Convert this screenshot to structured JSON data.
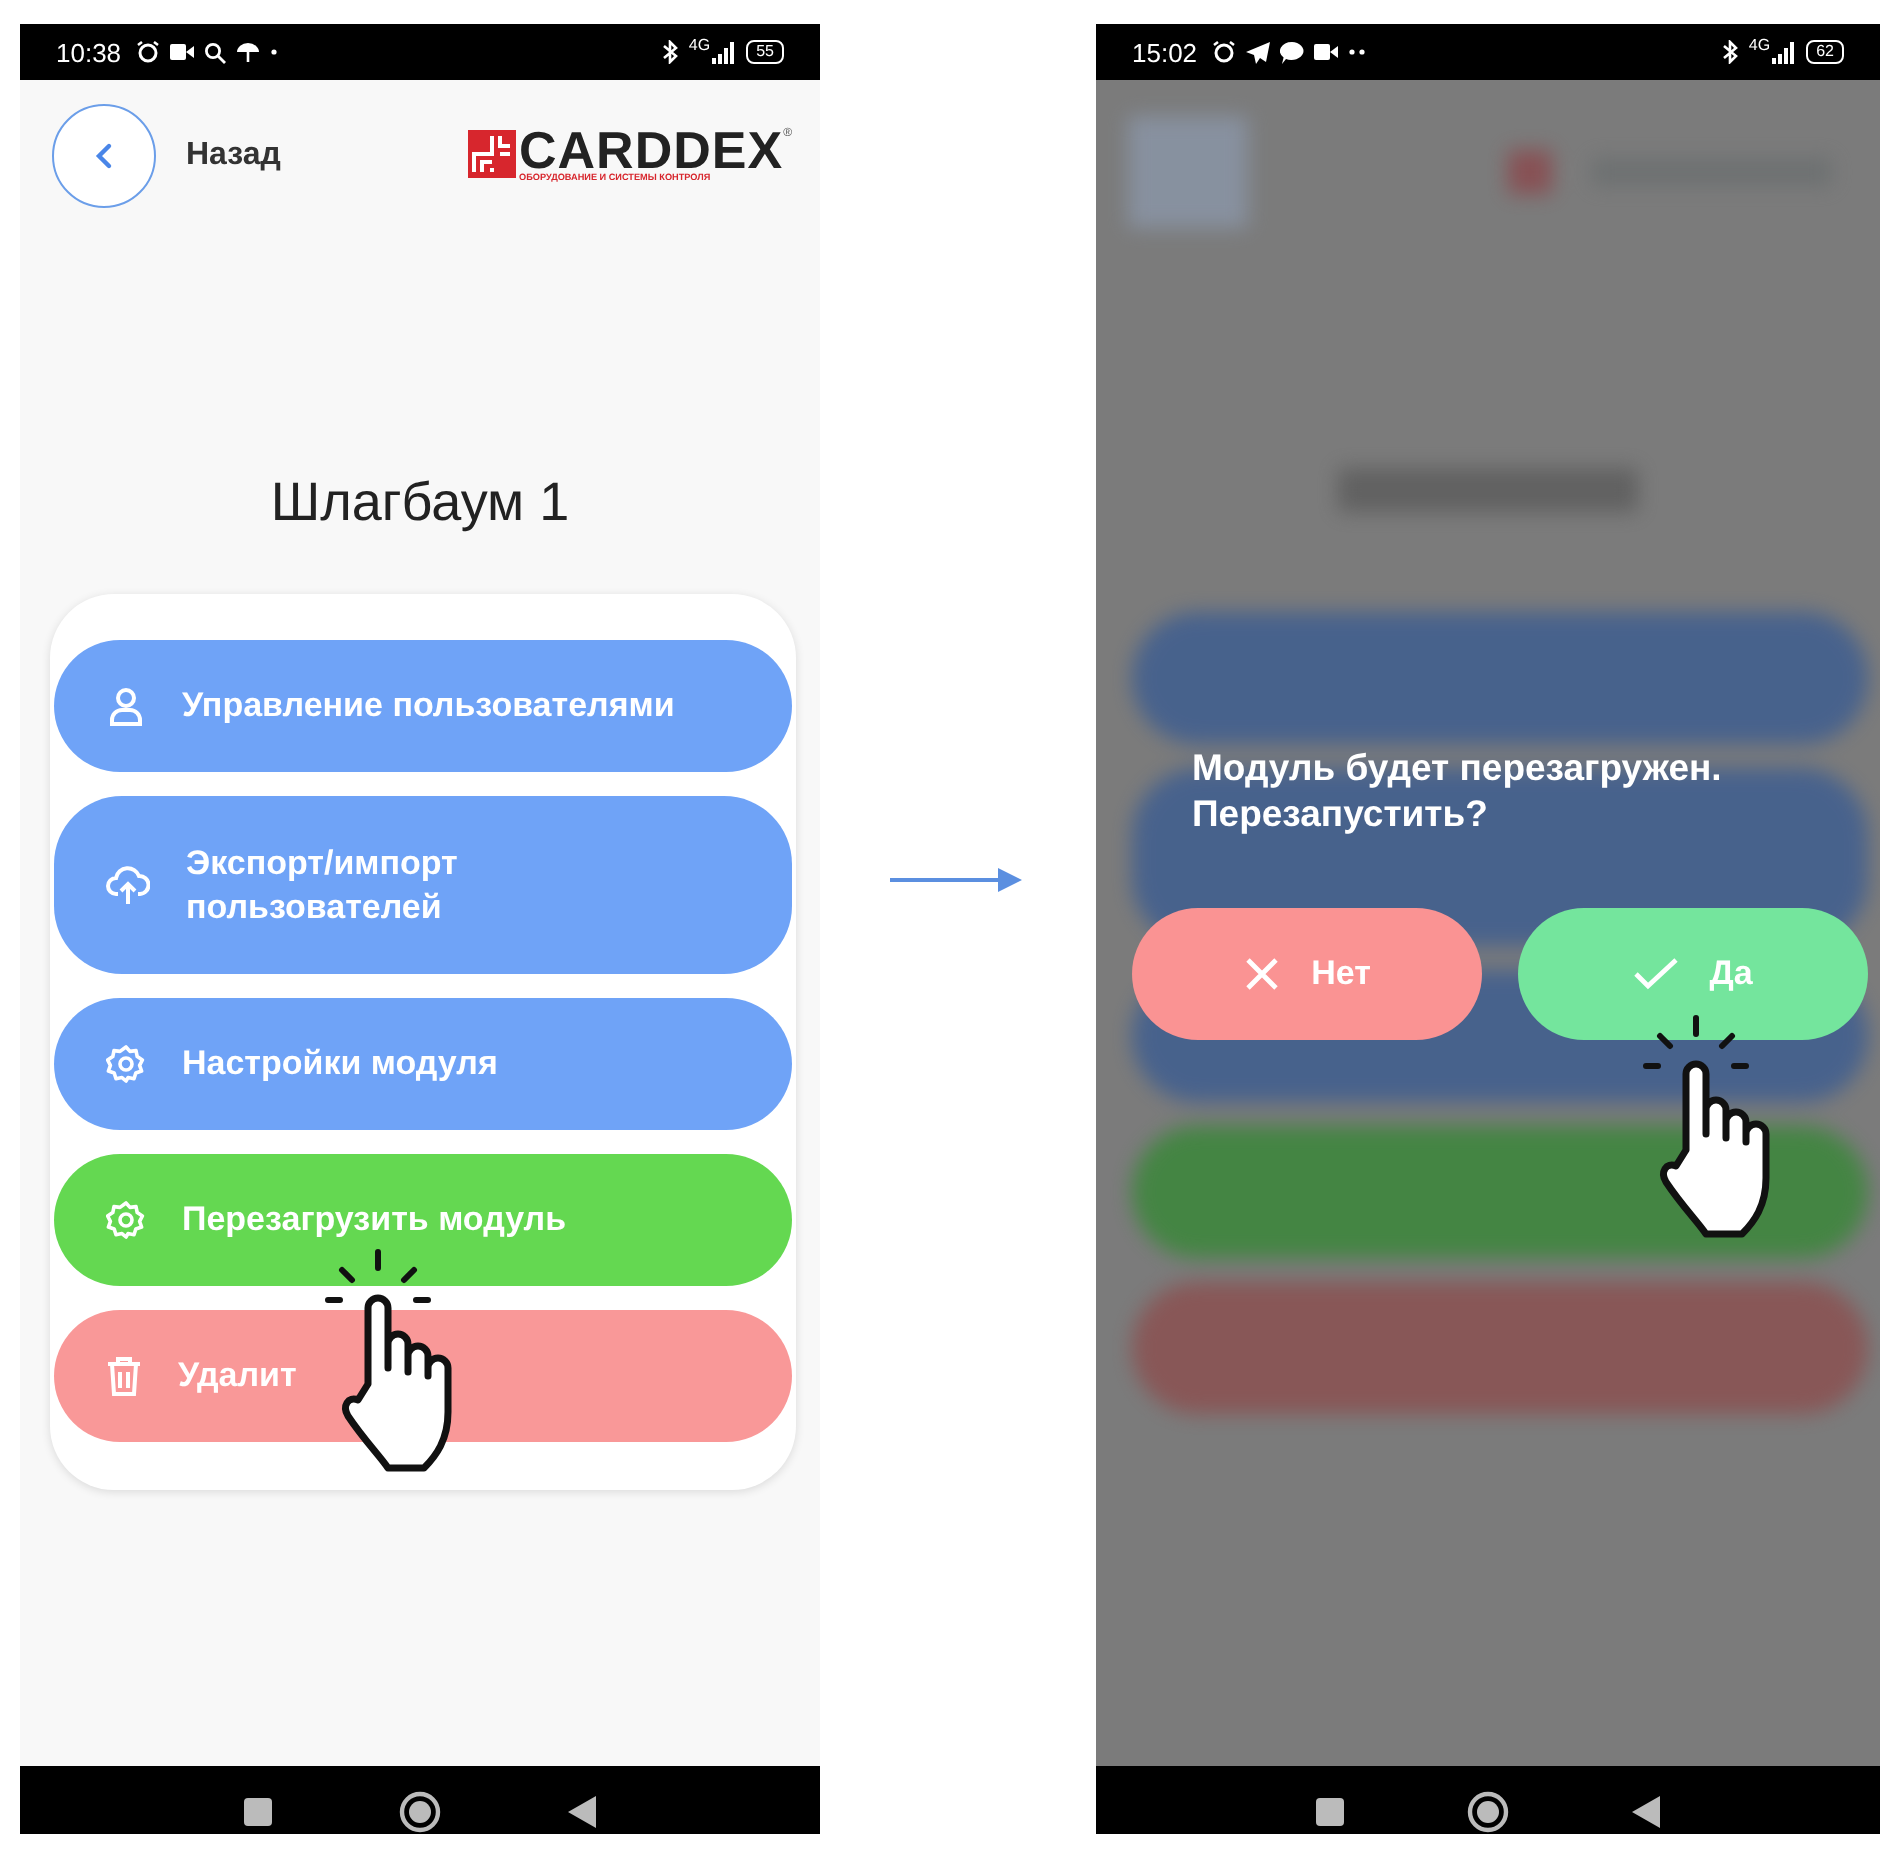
{
  "left_screen": {
    "status_bar": {
      "time": "10:38",
      "network": "4G",
      "battery": "55"
    },
    "header": {
      "back_label": "Назад",
      "logo": {
        "name": "CARDDEX",
        "mark": "®",
        "tagline": "ОБОРУДОВАНИЕ И СИСТЕМЫ КОНТРОЛЯ"
      }
    },
    "title": "Шлагбаум 1",
    "menu": [
      {
        "label": "Управление пользователями",
        "kind": "users",
        "color": "#6fa3f7"
      },
      {
        "label": "Экспорт/импорт пользователей",
        "kind": "transfer",
        "color": "#6fa3f7"
      },
      {
        "label": "Настройки модуля",
        "kind": "settings",
        "color": "#6fa3f7"
      },
      {
        "label": "Перезагрузить модуль",
        "kind": "settings",
        "color": "#64d851"
      },
      {
        "label": "Удалит",
        "kind": "delete",
        "color": "#f99898"
      }
    ]
  },
  "right_screen": {
    "status_bar": {
      "time": "15:02",
      "network": "4G",
      "battery": "62"
    },
    "dialog": {
      "message": "Модуль будет перезагружен.\nПерезапустить?",
      "buttons": [
        {
          "label": "Нет",
          "kind": "cancel",
          "color": "#fa9393"
        },
        {
          "label": "Да",
          "kind": "confirm",
          "color": "#74e59d"
        }
      ]
    }
  }
}
